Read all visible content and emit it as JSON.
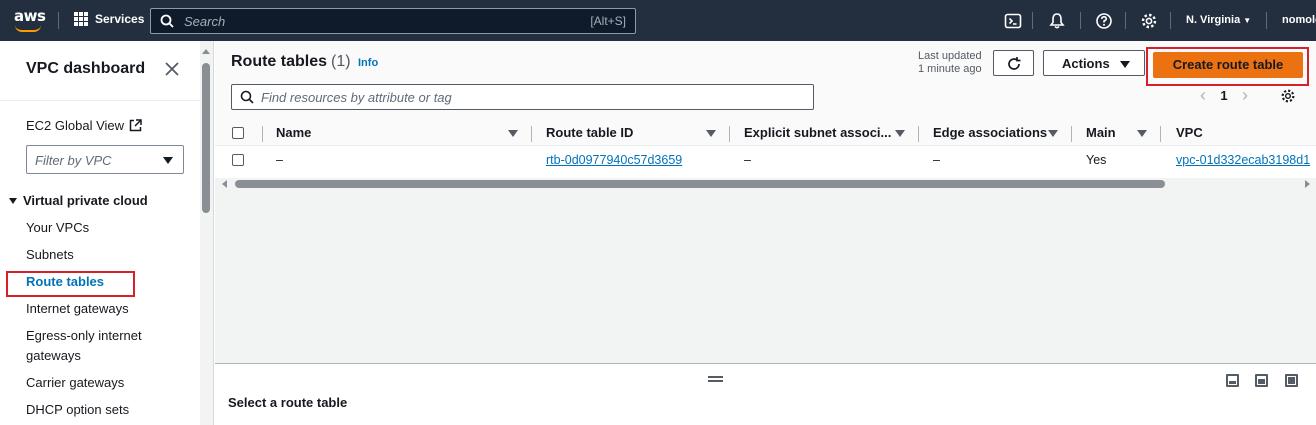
{
  "topnav": {
    "logo_text": "aws",
    "services_label": "Services",
    "search_placeholder": "Search",
    "search_shortcut": "[Alt+S]",
    "region": "N. Virginia",
    "user": "nomolo"
  },
  "sidebar": {
    "title": "VPC dashboard",
    "ec2_global_view": "EC2 Global View",
    "filter_placeholder": "Filter by VPC",
    "section_title": "Virtual private cloud",
    "items": [
      {
        "label": "Your VPCs"
      },
      {
        "label": "Subnets"
      },
      {
        "label": "Route tables"
      },
      {
        "label": "Internet gateways"
      },
      {
        "label": "Egress-only internet"
      },
      {
        "label": "gateways"
      },
      {
        "label": "Carrier gateways"
      },
      {
        "label": "DHCP option sets"
      }
    ]
  },
  "main": {
    "title": "Route tables",
    "count": "(1)",
    "info": "Info",
    "last_updated_line1": "Last updated",
    "last_updated_line2": "1 minute ago",
    "actions_label": "Actions",
    "create_label": "Create route table",
    "find_placeholder": "Find resources by attribute or tag",
    "page_number": "1",
    "columns": [
      "Name",
      "Route table ID",
      "Explicit subnet associ...",
      "Edge associations",
      "Main",
      "VPC"
    ],
    "rows": [
      {
        "name": "–",
        "route_table_id": "rtb-0d0977940c57d3659",
        "explicit_subnet": "–",
        "edge": "–",
        "main": "Yes",
        "vpc": "vpc-01d332ecab3198d1"
      }
    ],
    "details_title": "Select a route table"
  },
  "colors": {
    "nav_bg": "#232f3e",
    "accent_orange": "#ec7211",
    "link_blue": "#0073bb",
    "highlight_red": "#d6212b"
  }
}
